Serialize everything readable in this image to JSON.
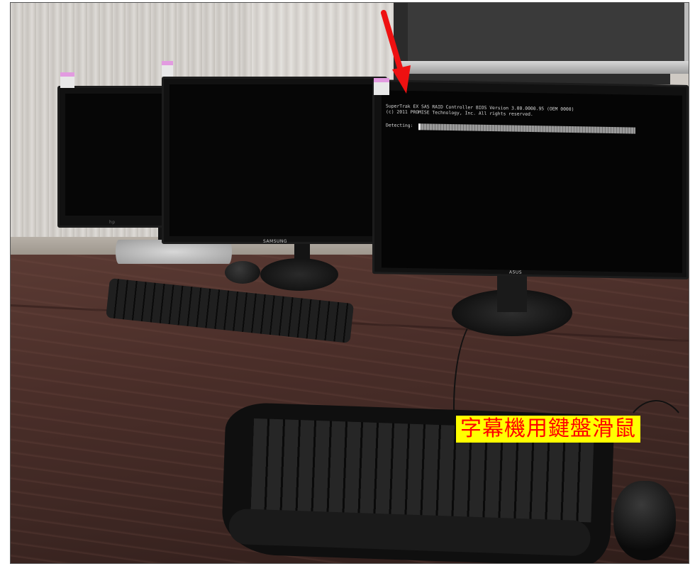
{
  "photo": {
    "description_alt": "Three monitors on a desk with keyboards and mice"
  },
  "monitors": {
    "left_brand": "hp",
    "middle_brand": "SAMSUNG",
    "right_brand": "ASUS"
  },
  "bios_screen": {
    "line1": "SuperTrak EX SAS RAID Controller BIOS Version 3.00.0000.95 (OEM 0000)",
    "line2": "(c) 2011 PROMISE Technology, Inc. All rights reserved.",
    "detecting_label": "Detecting:",
    "progress_fraction": 0.01
  },
  "caption": {
    "text": "字幕機用鍵盤滑鼠"
  },
  "colors": {
    "caption_bg": "#ffff00",
    "caption_text": "#ff0000",
    "arrow": "#ee1111"
  }
}
